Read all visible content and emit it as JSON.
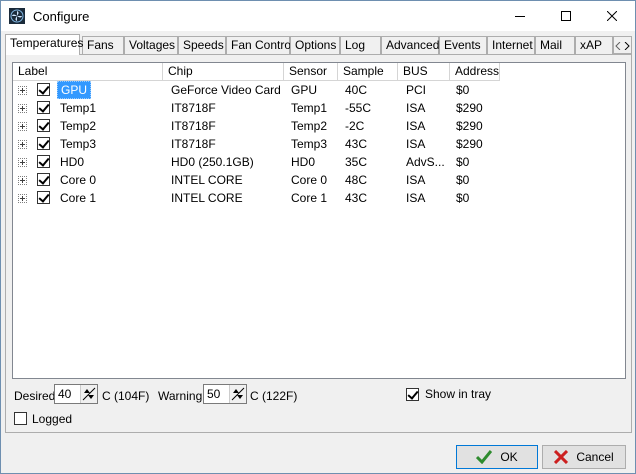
{
  "window": {
    "title": "Configure"
  },
  "tabs": [
    {
      "label": "Temperatures",
      "active": true
    },
    {
      "label": "Fans"
    },
    {
      "label": "Voltages"
    },
    {
      "label": "Speeds"
    },
    {
      "label": "Fan Control"
    },
    {
      "label": "Options"
    },
    {
      "label": "Log"
    },
    {
      "label": "Advanced"
    },
    {
      "label": "Events"
    },
    {
      "label": "Internet"
    },
    {
      "label": "Mail"
    },
    {
      "label": "xAP"
    }
  ],
  "table": {
    "columns": [
      "Label",
      "Chip",
      "Sensor",
      "Sample",
      "BUS",
      "Address"
    ],
    "rows": [
      {
        "label": "GPU",
        "chip": "GeForce Video Card",
        "sensor": "GPU",
        "sample": "40C",
        "bus": "PCI",
        "address": "$0",
        "checked": true,
        "selected": true
      },
      {
        "label": "Temp1",
        "chip": "IT8718F",
        "sensor": "Temp1",
        "sample": "-55C",
        "bus": "ISA",
        "address": "$290",
        "checked": true
      },
      {
        "label": "Temp2",
        "chip": "IT8718F",
        "sensor": "Temp2",
        "sample": "-2C",
        "bus": "ISA",
        "address": "$290",
        "checked": true
      },
      {
        "label": "Temp3",
        "chip": "IT8718F",
        "sensor": "Temp3",
        "sample": "43C",
        "bus": "ISA",
        "address": "$290",
        "checked": true
      },
      {
        "label": "HD0",
        "chip": "HD0 (250.1GB)",
        "sensor": "HD0",
        "sample": "35C",
        "bus": "AdvS...",
        "address": "$0",
        "checked": true
      },
      {
        "label": "Core 0",
        "chip": "INTEL CORE",
        "sensor": "Core 0",
        "sample": "48C",
        "bus": "ISA",
        "address": "$0",
        "checked": true
      },
      {
        "label": "Core 1",
        "chip": "INTEL CORE",
        "sensor": "Core 1",
        "sample": "43C",
        "bus": "ISA",
        "address": "$0",
        "checked": true
      }
    ]
  },
  "settings": {
    "desired_label": "Desired",
    "desired_value": "40",
    "desired_unit": "C (104F)",
    "warning_label": "Warning",
    "warning_value": "50",
    "warning_unit": "C (122F)",
    "show_in_tray_label": "Show in tray",
    "show_in_tray_checked": true,
    "logged_label": "Logged",
    "logged_checked": false
  },
  "buttons": {
    "ok": "OK",
    "cancel": "Cancel"
  },
  "colors": {
    "selection": "#3399ff",
    "ok_check": "#2e8b2e",
    "cancel_x": "#cc1f1f"
  }
}
